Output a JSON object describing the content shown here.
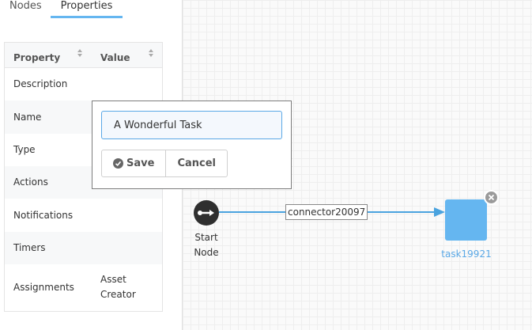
{
  "tabs": [
    {
      "label": "Nodes",
      "active": false
    },
    {
      "label": "Properties",
      "active": true
    }
  ],
  "properties_table": {
    "headers": {
      "property": "Property",
      "value": "Value"
    },
    "rows": [
      {
        "label": "Description",
        "value": ""
      },
      {
        "label": "Name",
        "value": ""
      },
      {
        "label": "Type",
        "value": ""
      },
      {
        "label": "Actions",
        "value": ""
      },
      {
        "label": "Notifications",
        "value": ""
      },
      {
        "label": "Timers",
        "value": ""
      },
      {
        "label": "Assignments",
        "value": "Asset Creator"
      }
    ]
  },
  "editor": {
    "name_value": "A Wonderful Task",
    "save_label": "Save",
    "cancel_label": "Cancel"
  },
  "diagram": {
    "start_node_label": "Start Node",
    "connector_label": "connector20097",
    "task_label": "task19921"
  },
  "colors": {
    "accent": "#65b6f0",
    "connector": "#4aa3df",
    "start_node": "#2f2f2f"
  }
}
